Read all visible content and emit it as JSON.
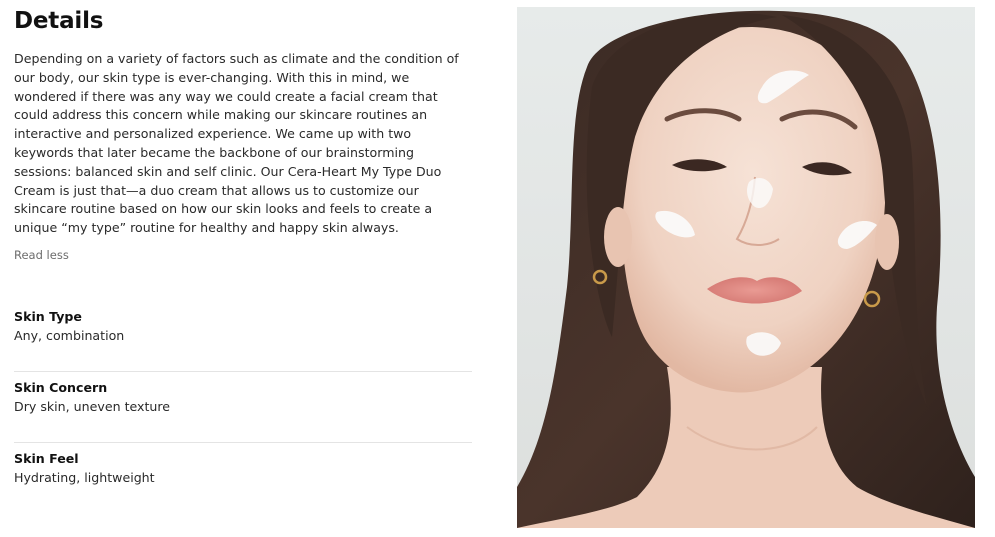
{
  "details": {
    "heading": "Details",
    "description": "Depending on a variety of factors such as climate and the condition of our body, our skin type is ever-changing. With this in mind, we wondered if there was any way we could create a facial cream that could address this concern while making our skincare routines an interactive and personalized experience. We came up with two keywords that later became the backbone of our brainstorming sessions: balanced skin and self clinic. Our Cera-Heart My Type Duo Cream is just that—a duo cream that allows us to customize our skincare routine based on how our skin looks and feels to create a unique “my type” routine for healthy and happy skin always.",
    "read_less_label": "Read less"
  },
  "specs": [
    {
      "label": "Skin Type",
      "value": "Any, combination"
    },
    {
      "label": "Skin Concern",
      "value": "Dry skin, uneven texture"
    },
    {
      "label": "Skin Feel",
      "value": "Hydrating, lightweight"
    }
  ],
  "photo": {
    "subject": "woman with cream dabbed on face"
  }
}
